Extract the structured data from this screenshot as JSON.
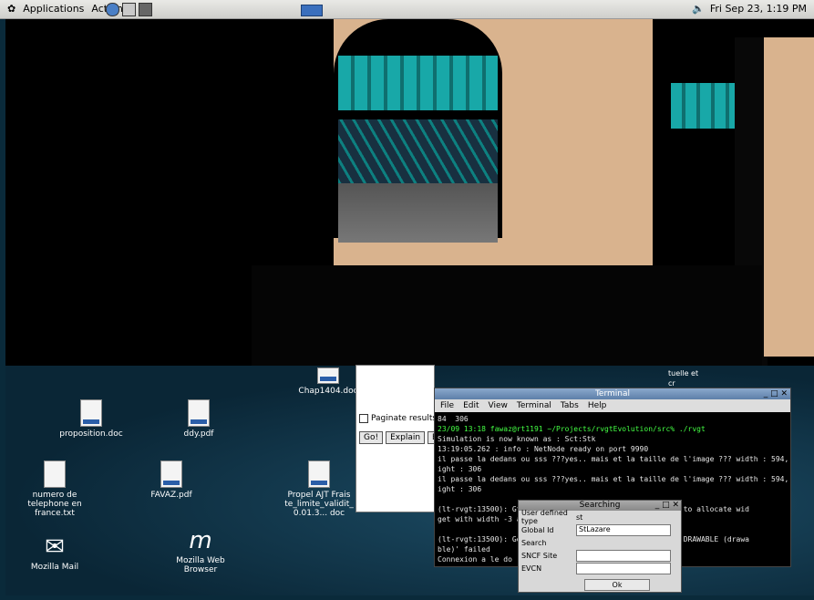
{
  "topbar": {
    "applications": "Applications",
    "actions": "Actions",
    "clock": "Fri Sep 23,  1:19 PM"
  },
  "desktop_icons": [
    {
      "label": "proposition.doc"
    },
    {
      "label": "ddy.pdf"
    },
    {
      "label": "numero de telephone en france.txt"
    },
    {
      "label": "FAVAZ.pdf"
    },
    {
      "label": "Propel AJT Frais te_limite_validit_ 0.01.3... doc"
    },
    {
      "label": "Chap1404.doc"
    },
    {
      "label": "Mozilla Mail"
    },
    {
      "label": "Mozilla Web Browser"
    }
  ],
  "panel": {
    "paginate": "Paginate results",
    "go": "Go!",
    "explain": "Explain",
    "ex": "Ex"
  },
  "terminal": {
    "title": "Terminal",
    "menus": [
      "File",
      "Edit",
      "View",
      "Terminal",
      "Tabs",
      "Help"
    ],
    "lines": [
      "84  306",
      "23/09 13:18 fawaz@rt1191 ~/Projects/rvgtEvolution/src% ./rvgt",
      "Simulation is now known as : Sct:Stk",
      "13:19:05.262 : info : NetNode ready on port 9990",
      "il passe la dedans ou sss ???yes.. mais et la taille de l'image ??? width : 594, he",
      "ight : 306",
      "il passe la dedans ou sss ???yes.. mais et la taille de l'image ??? width : 594, he",
      "ight : 306",
      "",
      "(lt-rvgt:13500): Gtk                            attempt to allocate wid",
      "get with width -3 and",
      "",
      "(lt-rvgt:13500): Gdk                             GDK IS DRAWABLE (drawa",
      "ble)' failed",
      "Connexion a le do"
    ]
  },
  "search": {
    "title": "Searching",
    "user_defined": "User defined type",
    "user_value": "st",
    "global_id": "Global Id",
    "global_value": "StLazare",
    "search": "Search",
    "sncf": "SNCF Site",
    "evcn": "EVCN",
    "ok": "Ok"
  },
  "misc": {
    "chap": "Chap1404.doc",
    "tuelle": "tuelle et",
    "cr": "cr"
  }
}
